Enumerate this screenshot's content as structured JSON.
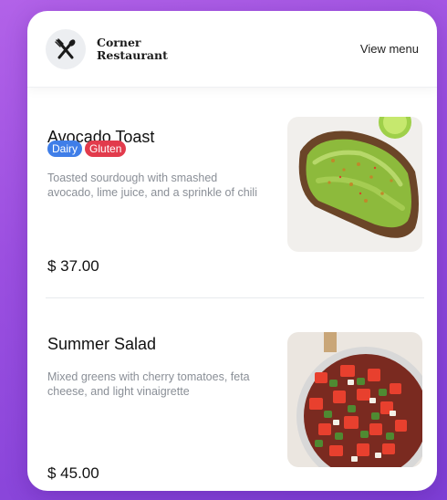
{
  "brand": {
    "line1": "Corner",
    "line2": "Restaurant"
  },
  "header": {
    "view_menu": "View menu"
  },
  "items": [
    {
      "name": "Avocado Toast",
      "tags": [
        "Dairy",
        "Gluten"
      ],
      "description": "Toasted sourdough with smashed avocado, lime juice, and a sprinkle of chili",
      "price": "$ 37.00",
      "image": "avocado-toast-photo"
    },
    {
      "name": "Summer Salad",
      "tags": [],
      "description": "Mixed greens with cherry tomatoes, feta cheese, and light vinaigrette",
      "price": "$ 45.00",
      "image": "summer-salad-photo"
    }
  ],
  "colors": {
    "background": "#9b4fe0",
    "tag_dairy": "#3f7ee8",
    "tag_gluten": "#e23b4c"
  },
  "icons": {
    "logo": "fork-knife-icon"
  }
}
